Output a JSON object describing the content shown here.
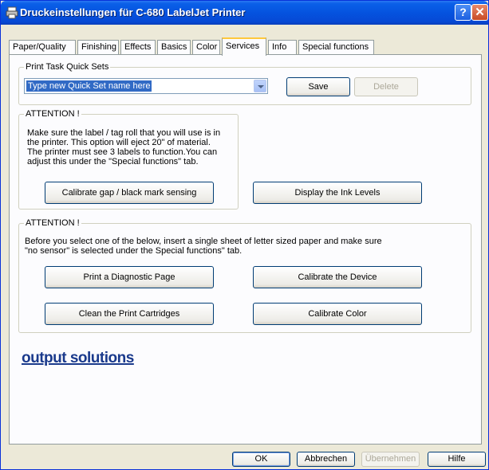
{
  "window": {
    "title": "Druckeinstellungen für C-680 LabelJet Printer",
    "help_label": "?",
    "close_label": "✕"
  },
  "tabs": [
    {
      "label": "Paper/Quality"
    },
    {
      "label": "Finishing"
    },
    {
      "label": "Effects"
    },
    {
      "label": "Basics"
    },
    {
      "label": "Color"
    },
    {
      "label": "Services",
      "active": true
    },
    {
      "label": "Info"
    },
    {
      "label": "Special functions"
    }
  ],
  "quick_sets": {
    "legend": "Print Task Quick Sets",
    "combo_value": "Type new Quick Set name here",
    "save_label": "Save",
    "delete_label": "Delete"
  },
  "attention1": {
    "legend": "ATTENTION !",
    "text_line1": "Make sure the label / tag roll that you will use is in",
    "text_line2": "the printer. This option will eject 20\" of material.",
    "text_line3": "The printer must see 3 labels to function.You can",
    "text_line4": "adjust this under the \"Special functions\" tab.",
    "calibrate_gap_label": "Calibrate gap / black mark sensing"
  },
  "ink_levels_label": "Display the Ink Levels",
  "attention2": {
    "legend": "ATTENTION !",
    "text_line1": "Before you select one of the below, insert a single sheet of letter sized paper and make sure",
    "text_line2": "\"no sensor\" is selected under the Special functions\" tab.",
    "diagnostic_label": "Print a Diagnostic Page",
    "calibrate_device_label": "Calibrate the Device",
    "clean_label": "Clean the Print Cartridges",
    "calibrate_color_label": "Calibrate Color"
  },
  "logo_text": "output solutions",
  "footer": {
    "ok_label": "OK",
    "cancel_label": "Abbrechen",
    "apply_label": "Übernehmen",
    "help_label": "Hilfe"
  }
}
